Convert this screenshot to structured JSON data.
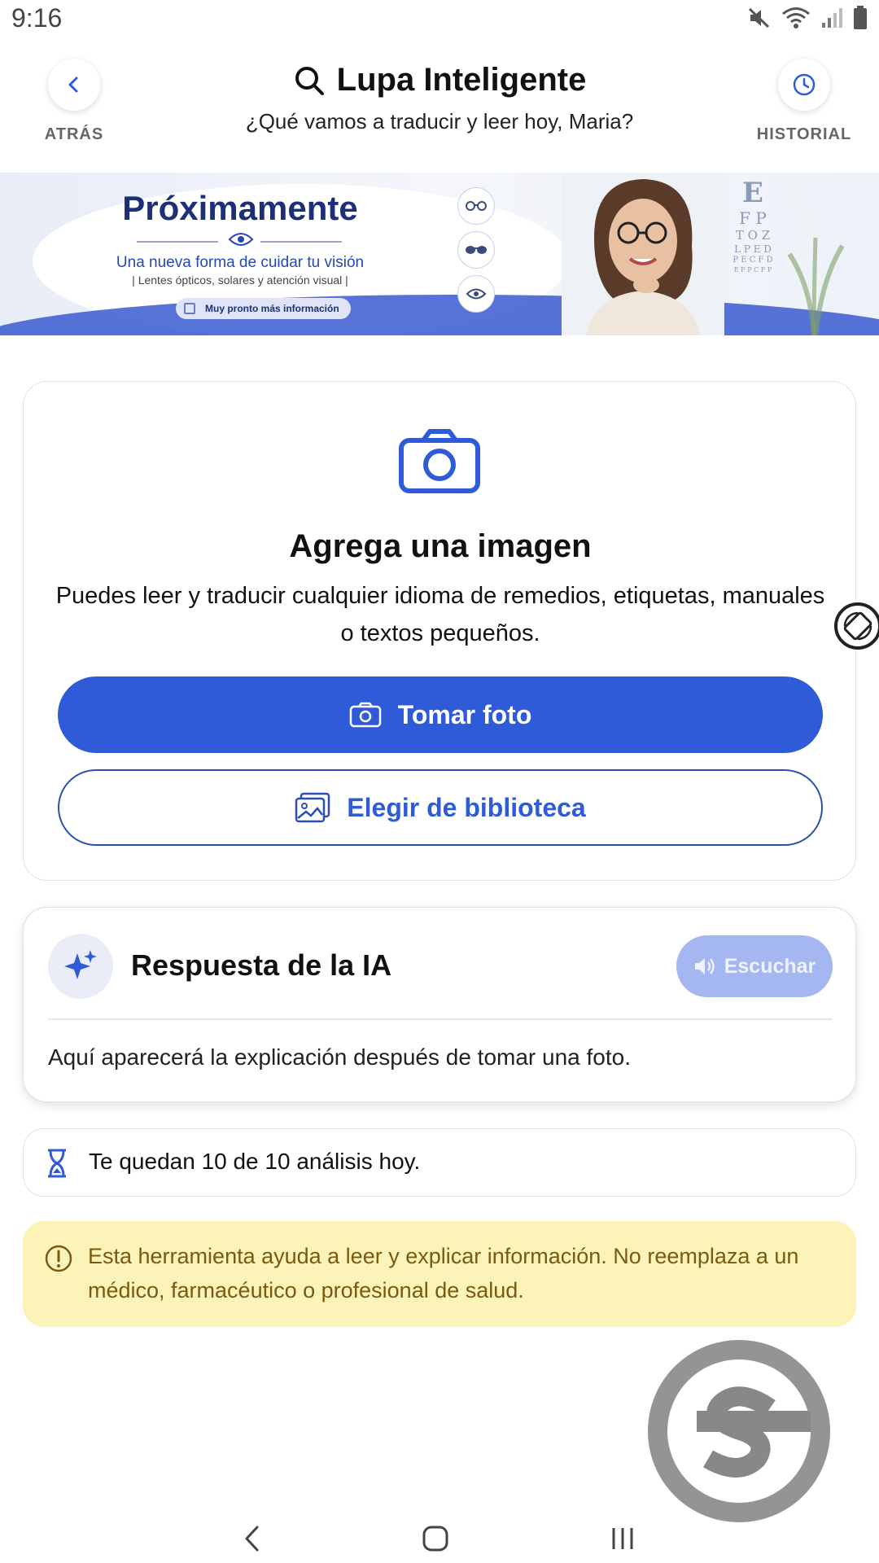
{
  "status_bar": {
    "time": "9:16"
  },
  "header": {
    "title": "Lupa Inteligente",
    "subtitle": "¿Qué vamos a traducir y leer hoy, Maria?",
    "back_label": "ATRÁS",
    "history_label": "HISTORIAL"
  },
  "banner": {
    "title": "Próximamente",
    "tagline": "Una nueva forma de cuidar tu visión",
    "detail": "| Lentes ópticos, solares y atención visual |",
    "cta": "Muy pronto más información",
    "eye_chart": [
      "E",
      "F P",
      "T O Z",
      "L P E D",
      "P E C F D",
      "E F P C F P"
    ]
  },
  "image_card": {
    "title": "Agrega una imagen",
    "description": "Puedes leer y traducir cualquier idioma de remedios, etiquetas, manuales o textos pequeños.",
    "take_photo_label": "Tomar foto",
    "library_label": "Elegir de biblioteca"
  },
  "ai_card": {
    "title": "Respuesta de la IA",
    "listen_label": "Escuchar",
    "body": "Aquí aparecerá la explicación después de tomar una foto."
  },
  "quota": {
    "text": "Te quedan 10 de 10 análisis hoy."
  },
  "warning": {
    "text": "Esta herramienta ayuda a leer y explicar información. No reemplaza a un médico, farmacéutico o profesional de salud."
  },
  "colors": {
    "primary": "#2f5ad8",
    "primary_disabled": "#a5b7f1",
    "warning_bg": "#fbf3b8",
    "warning_text": "#7a5a10",
    "banner_title": "#1e2f7a"
  }
}
